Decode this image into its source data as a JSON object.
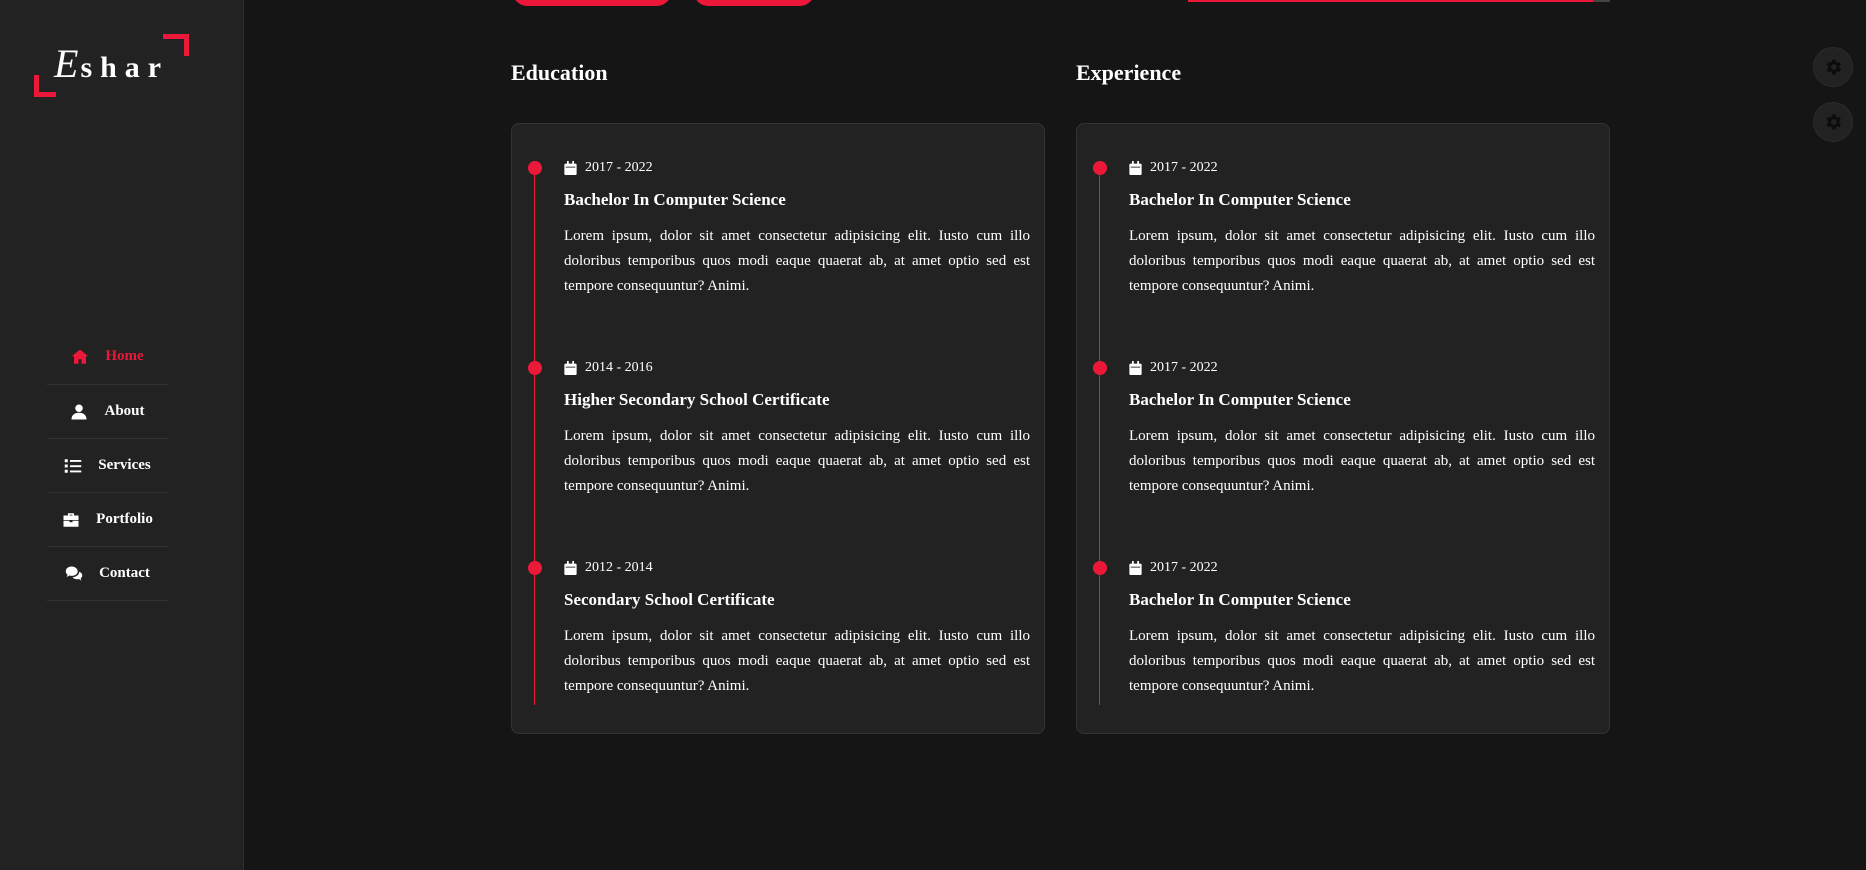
{
  "brand": {
    "logo_first": "E",
    "logo_rest": "shar"
  },
  "nav": [
    {
      "label": "Home",
      "icon": "home-icon",
      "active": true
    },
    {
      "label": "About",
      "icon": "user-icon",
      "active": false
    },
    {
      "label": "Services",
      "icon": "list-icon",
      "active": false
    },
    {
      "label": "Portfolio",
      "icon": "briefcase-icon",
      "active": false
    },
    {
      "label": "Contact",
      "icon": "comments-icon",
      "active": false
    }
  ],
  "education": {
    "title": "Education",
    "items": [
      {
        "date": "2017 - 2022",
        "title": "Bachelor In Computer Science",
        "text": "Lorem ipsum, dolor sit amet consectetur adipisicing elit. Iusto cum illo doloribus temporibus quos modi eaque quaerat ab, at amet optio sed est tempore consequuntur? Animi."
      },
      {
        "date": "2014 - 2016",
        "title": "Higher Secondary School Certificate",
        "text": "Lorem ipsum, dolor sit amet consectetur adipisicing elit. Iusto cum illo doloribus temporibus quos modi eaque quaerat ab, at amet optio sed est tempore consequuntur? Animi."
      },
      {
        "date": "2012 - 2014",
        "title": "Secondary School Certificate",
        "text": "Lorem ipsum, dolor sit amet consectetur adipisicing elit. Iusto cum illo doloribus temporibus quos modi eaque quaerat ab, at amet optio sed est tempore consequuntur? Animi."
      }
    ]
  },
  "experience": {
    "title": "Experience",
    "items": [
      {
        "date": "2017 - 2022",
        "title": "Bachelor In Computer Science",
        "text": "Lorem ipsum, dolor sit amet consectetur adipisicing elit. Iusto cum illo doloribus temporibus quos modi eaque quaerat ab, at amet optio sed est tempore consequuntur? Animi."
      },
      {
        "date": "2017 - 2022",
        "title": "Bachelor In Computer Science",
        "text": "Lorem ipsum, dolor sit amet consectetur adipisicing elit. Iusto cum illo doloribus temporibus quos modi eaque quaerat ab, at amet optio sed est tempore consequuntur? Animi."
      },
      {
        "date": "2017 - 2022",
        "title": "Bachelor In Computer Science",
        "text": "Lorem ipsum, dolor sit amet consectetur adipisicing elit. Iusto cum illo doloribus temporibus quos modi eaque quaerat ab, at amet optio sed est tempore consequuntur? Animi."
      }
    ]
  },
  "colors": {
    "accent": "#ec1839",
    "background": "#151515",
    "panel": "#222222"
  },
  "icons": {
    "calendar": "calendar-icon",
    "settings": "gear-icon"
  }
}
